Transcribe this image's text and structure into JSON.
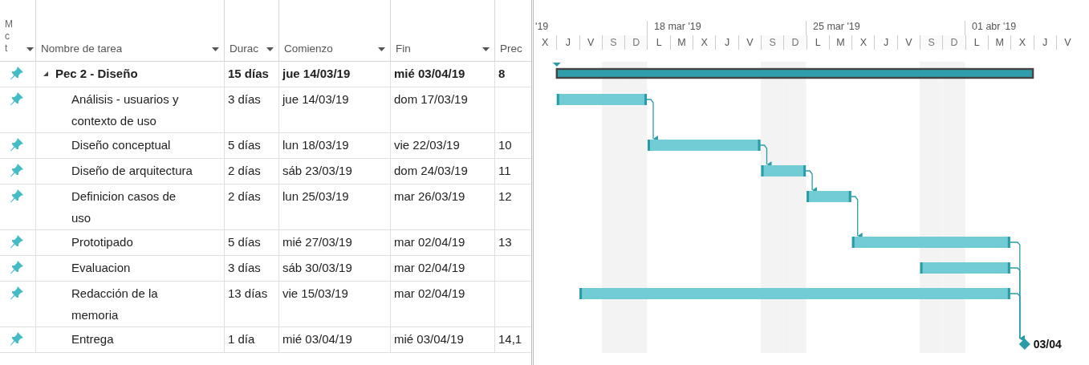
{
  "table": {
    "columns": [
      {
        "lines": [
          "M",
          "c",
          "t"
        ],
        "filter": true
      },
      {
        "label": "Nombre de tarea",
        "filter": true
      },
      {
        "label": "Durac",
        "filter": true
      },
      {
        "label": "Comienzo",
        "filter": true
      },
      {
        "label": "Fin",
        "filter": true
      },
      {
        "label": "Prec",
        "filter": false
      }
    ],
    "rows": [
      {
        "kind": "summary",
        "expanded": true,
        "name": "Pec 2 - Diseño",
        "duration": "15 días",
        "start": "jue 14/03/19",
        "end": "mié 03/04/19",
        "pred": "8"
      },
      {
        "kind": "task",
        "name": "Análisis - usuarios y contexto de uso",
        "duration": "3 días",
        "start": "jue 14/03/19",
        "end": "dom 17/03/19",
        "links_to_next": true,
        "links_to_milestone": false
      },
      {
        "kind": "task",
        "name": "Diseño conceptual",
        "duration": "5 días",
        "start": "lun 18/03/19",
        "end": "vie 22/03/19",
        "pred": "10",
        "links_to_next": true,
        "links_to_milestone": false
      },
      {
        "kind": "task",
        "name": "Diseño de arquitectura",
        "duration": "2 días",
        "start": "sáb 23/03/19",
        "end": "dom 24/03/19",
        "pred": "11",
        "links_to_next": true,
        "links_to_milestone": false
      },
      {
        "kind": "task",
        "name": "Definicion casos de uso",
        "duration": "2 días",
        "start": "lun 25/03/19",
        "end": "mar 26/03/19",
        "pred": "12",
        "links_to_next": true,
        "links_to_milestone": false
      },
      {
        "kind": "task",
        "name": "Prototipado",
        "duration": "5 días",
        "start": "mié 27/03/19",
        "end": "mar 02/04/19",
        "pred": "13",
        "links_to_next": false,
        "links_to_milestone": true
      },
      {
        "kind": "task",
        "name": "Evaluacion",
        "duration": "3 días",
        "start": "sáb 30/03/19",
        "end": "mar 02/04/19",
        "links_to_next": false,
        "links_to_milestone": true
      },
      {
        "kind": "task",
        "name": "Redacción de la memoria",
        "duration": "13 días",
        "start": "vie 15/03/19",
        "end": "mar 02/04/19",
        "links_to_next": false,
        "links_to_milestone": true
      },
      {
        "kind": "milestone",
        "name": "Entrega",
        "duration": "1 día",
        "start": "mié 03/04/19",
        "end": "mié 03/04/19",
        "pred": "14,1",
        "milestone_label": "03/04"
      }
    ]
  },
  "timescale": {
    "weeks": [
      {
        "label": "'19"
      },
      {
        "label": "18 mar '19"
      },
      {
        "label": "25 mar '19"
      },
      {
        "label": "01 abr '19"
      }
    ],
    "days": [
      {
        "label": "X",
        "weekend": false
      },
      {
        "label": "J",
        "weekend": false
      },
      {
        "label": "V",
        "weekend": false
      },
      {
        "label": "S",
        "weekend": true
      },
      {
        "label": "D",
        "weekend": true
      },
      {
        "label": "L",
        "weekend": false
      },
      {
        "label": "M",
        "weekend": false
      },
      {
        "label": "X",
        "weekend": false
      },
      {
        "label": "J",
        "weekend": false
      },
      {
        "label": "V",
        "weekend": false
      },
      {
        "label": "S",
        "weekend": true
      },
      {
        "label": "D",
        "weekend": true
      },
      {
        "label": "L",
        "weekend": false
      },
      {
        "label": "M",
        "weekend": false
      },
      {
        "label": "X",
        "weekend": false
      },
      {
        "label": "J",
        "weekend": false
      },
      {
        "label": "V",
        "weekend": false
      },
      {
        "label": "S",
        "weekend": true
      },
      {
        "label": "D",
        "weekend": true
      },
      {
        "label": "L",
        "weekend": false
      },
      {
        "label": "M",
        "weekend": false
      },
      {
        "label": "X",
        "weekend": false
      },
      {
        "label": "J",
        "weekend": false
      },
      {
        "label": "V",
        "weekend": false
      }
    ]
  }
}
